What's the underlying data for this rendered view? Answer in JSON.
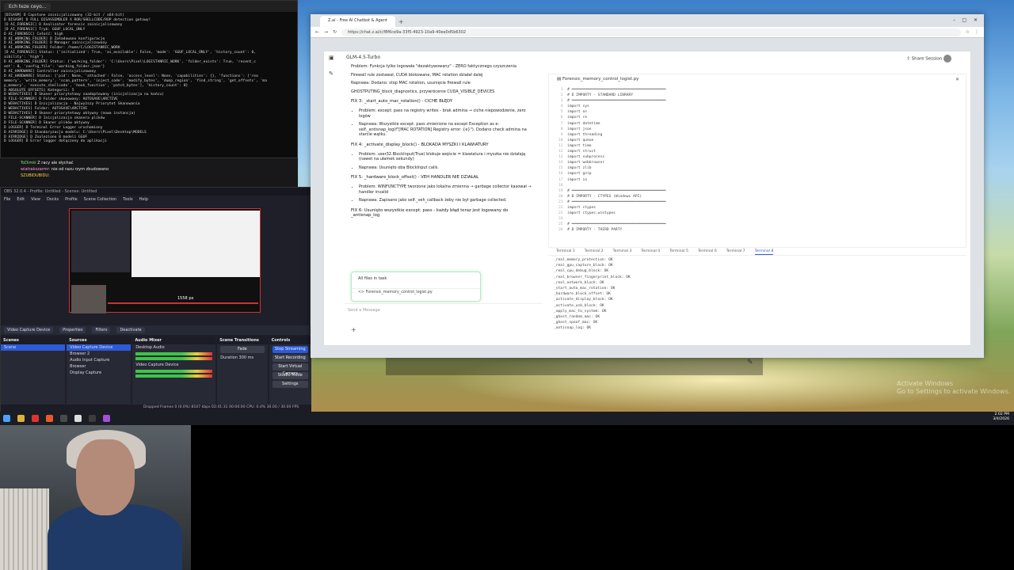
{
  "terminal": {
    "tab_label": "Ech teze ceyo...",
    "lines": [
      "[DISASM] D Capstone zainicjalizowany (32-bit / x64-bit)",
      "D DISASM] D FULL DISASSEMBLER X ROR/SHELLCODE/ROP detection gotowy!",
      "[O AI_FORENSIC] D Analizator forensic zainicjalizowany",
      "[D AI_FORENSIC]   Tryb: GGUF_LOCAL_ONLY",
      "D AI_FORENSIC]   Całość: high",
      "D AI_WORKING_FOLDER] D Załadowano konfigurację",
      "D AI_WORKING_FOLDER] D Manager zainicjalizowany",
      "D AI_WORKING_FOLDER]   Folder: /home/C/LOGISTANRIC_WORK",
      "[D AI_FORENSIC] Status: {'initialized': True, 'ai_available': False, 'mode': 'GGUF_LOCAL_ONLY', 'history_count': 0,",
      "aibility': 'high'}",
      "D AI_WORKING_FOLDER] Status: {'working_folder': 'C:\\Users\\Pixel\\LOGISTANRIC_WORK', 'folder_exists': True, 'recent_c",
      "ent': 0, 'config_file': 'working_folder.json'}",
      "D AI_HARDWARE] Controller zainicjalizowany",
      "D AI_HARDWARE] Status: {'pid': None, 'attached': False, 'access_level': None, 'capabilities': {}, 'functions': ['rea",
      "memory', 'write_memory', 'scan_pattern', 'inject_code', 'modify_bytes', 'dump_region', 'find_string', 'get_offsets', 'ma",
      "p_memory', 'execute_shellcode', 'hook_function', 'patch_bytes'], 'history_count': 0}",
      "D ABSOLUTE OFFSETS] Kategorii: 5",
      "D WEBACTIVES] D Skaner priorytetowy zaadaptowany (inicjalizacja na końcu)",
      "D FILE-SCANNER] D Folder skanowany: AUTOSAVE\\ARCTIVE",
      "D WEBACTIVES] D Inicjalizacja - Najwyższy Priorytet Skanowania",
      "D WEBACTIVES]   Folder: AUTOSAVE\\ARCTIVE",
      "D WEBACTIVES] D Skaner priorytetowy aktywny (nowa instancja)",
      "D FILE-SCANNER] D Inicjalizacja skanera plików",
      "D FILE-SCANNER] D Skaner plików aktywny",
      "D LOGGER] D Terminal Error Logger uruchomiony",
      "D AIRRIDGE] D Standaryzacja modelu: C:\\Users\\Pixel\\Desktop\\MODELS",
      "D AIRRIDGE] D Znaleziono 0 modeli GGUF",
      "D LOGGER] D Error logger dołączony do aplikacji"
    ]
  },
  "chat_overlay": {
    "line1_user": "ToDimki",
    "line1_text": "Z racy ale słychać",
    "line2_user": "wiatrakszarmr:",
    "line2_text": "nie od razu rzym zbudowano",
    "line3_user": "SZUBIDUBIDU:"
  },
  "obs": {
    "title": "OBS 32.0.4 - Profile: Untitled - Scenes: Untitled",
    "menu": [
      "File",
      "Edit",
      "View",
      "Docks",
      "Profile",
      "Scene Collection",
      "Tools",
      "Help"
    ],
    "preview_px": "1558 px",
    "dock_tabs": [
      "Video Capture Device",
      "Properties",
      "Filters",
      "Deactivate"
    ],
    "scenes_header": "Scenes",
    "scenes": [
      "Scene"
    ],
    "sources_header": "Sources",
    "sources": [
      "Video Capture Device",
      "Browser 2",
      "Audio Input Capture",
      "Browser",
      "Display Capture"
    ],
    "mixer_header": "Audio Mixer",
    "mixer_items": [
      "Desktop Audio",
      "Video Capture Device"
    ],
    "transitions_header": "Scene Transitions",
    "transition": "Fade",
    "duration_label": "Duration",
    "duration_value": "300 ms",
    "controls_header": "Controls",
    "controls": [
      "Stop Streaming",
      "Start Recording",
      "Start Virtual Camera",
      "Studio Mode",
      "Settings"
    ],
    "status": "Dropped Frames 0 (0.0%)   8107 kbps   02:41:31   00:00:00   CPU: 0.4%   30.00 / 30.00 FPS"
  },
  "browser": {
    "tab_title": "Z.ai - Free AI Chatbot & Agent",
    "url": "https://chat.z.ai/c/f8f6ce9a-33f5-4923-10a9-40ee0d5b6302",
    "model": "GLM-4.5-Turbo",
    "share": "Share Session",
    "chat_paragraphs": [
      "Problem: Funkcja tylko logowała \"dezaktywowany\" - ZERO faktycznego czyszczenia",
      "Firewall rule zostawał, CUDA blokowane, MAC rotation działał dalej",
      "Naprawa: Dodano: stop MAC rotation, usunięcie firewall rule",
      "GHOSTPUTING_block_diagnostics, przywrócenie CUDA_VISIBLE_DEVICES"
    ],
    "fix3_title": "FIX 3: _start_auto_mac_rotation() - CICHE BŁĘDY",
    "fix3_items": [
      "Problem: except: pass na registry writes - brak admina → ciche niepowodzenie, zero logów",
      "Naprawa: Wszystkie except: pass zmienione na except Exception as e: self._antisnap_log(f\"[MAC ROTATION] Registry error: {e}\"). Dodano check admina na starcie wątku."
    ],
    "fix4_title": "FIX 4: _activate_display_block() - BLOKADA MYSZKI I KLAWIATURY",
    "fix4_items": [
      "Problem: user32.BlockInput(True) blokuje wejście = klawiatura i myszka nie działają (nawet na ułamek sekundy)",
      "Naprawa: Usunięto oba BlockInput calls."
    ],
    "fix5_title": "FIX 5: _hardware_block_offset() - VEH HANDLER NIE DZIAŁAŁ",
    "fix5_items": [
      "Problem: WINFUNCTYPE tworzone jako lokalna zmienna → garbage collector kasował → handler invalid",
      "Naprawa: Zapisano jako self._veh_callback żeby nie był garbage collected."
    ],
    "fix6_title": "FIX 6: Usunięto wszystkie except: pass - każdy błąd teraz jest logowany do _antisnap_log",
    "todo_title": "All files in task",
    "todo_file": "<> Forensic_memory_control_logist.py",
    "message_placeholder": "Send a Message",
    "file_title": "Forensic_memory_control_logist.py",
    "code": [
      "# ═══════════════════════════════════════════",
      "# D IMPORTY - STANDARD LIBRARY",
      "# ═══════════════════════════════════════════",
      "import sys",
      "import os",
      "import re",
      "import datetime",
      "import json",
      "import threading",
      "import queue",
      "import time",
      "import struct",
      "import subprocess",
      "import webbrowser",
      "import zlib",
      "import gzip",
      "import io",
      "",
      "# ═══════════════════════════════════════════",
      "# D IMPORTY - CTYPES (Windows API)",
      "# ═══════════════════════════════════════════",
      "import ctypes",
      "import ctypes.wintypes",
      "",
      "# ═══════════════════════════════════════════",
      "# D IMPORTY - THIRD PARTY"
    ],
    "terminal_tabs": [
      "Terminal 1",
      "Terminal 2",
      "Terminal 3",
      "Terminal 4",
      "Terminal 5",
      "Terminal 6",
      "Terminal 7",
      "Terminal 8"
    ],
    "terminal_output": [
      "_real_memory_protection: OK",
      "_real_gpu_capture_block: OK",
      "_real_cpu_debug_block: OK",
      "_real_browser_fingerprint_block: OK",
      "_real_network_block: OK",
      "_start_auto_mac_rotation: OK",
      "_hardware_block_offset: OK",
      "_activate_display_block: OK",
      "_activate_usb_block: OK",
      "_apply_mac_to_system: OK",
      "_ghost_random_mac: OK",
      "_ghost_spoof_mac: OK",
      "_antisnap_log: OK"
    ]
  },
  "watermark": {
    "line1": "Activate Windows",
    "line2": "Go to Settings to activate Windows."
  },
  "clock": {
    "time": "2:02 PM",
    "date": "3/4/2026"
  }
}
